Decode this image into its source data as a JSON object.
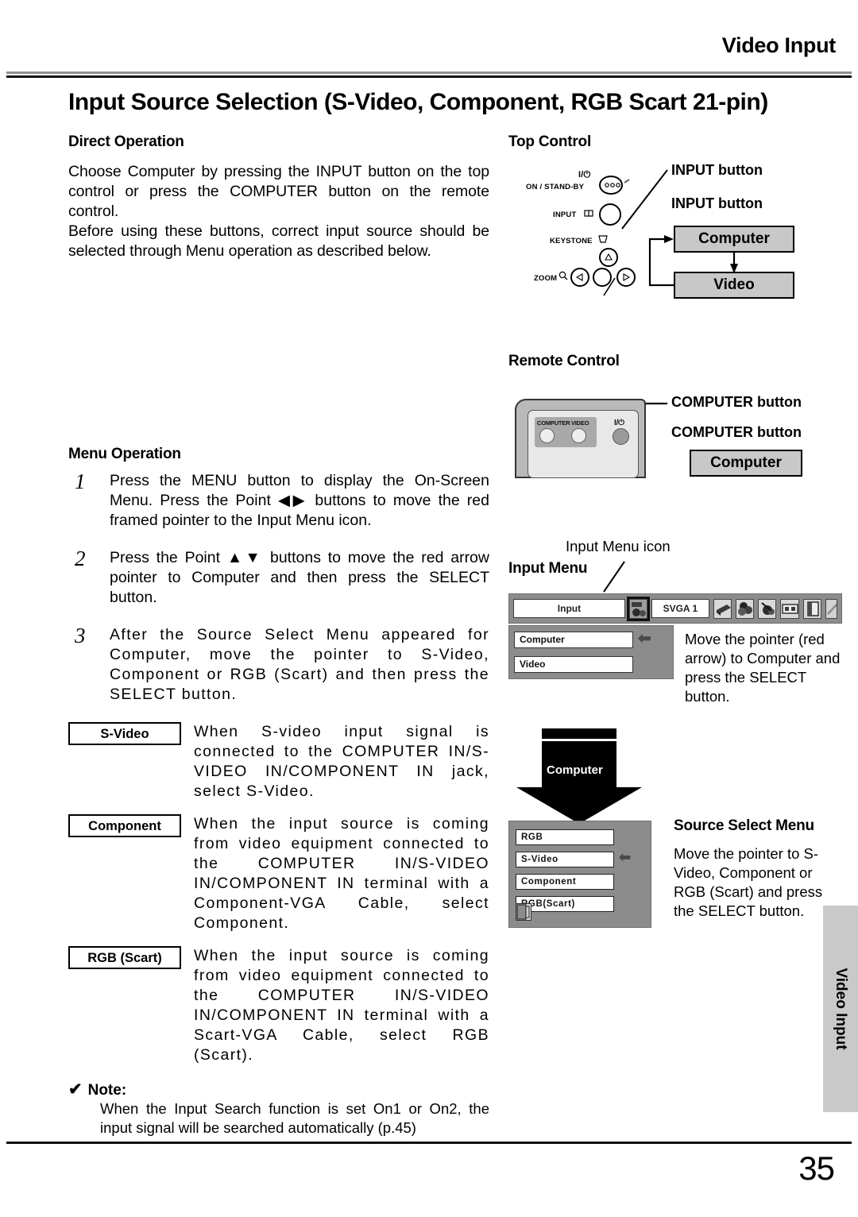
{
  "header": {
    "running_head": "Video Input"
  },
  "title": "Input Source Selection (S-Video, Component, RGB Scart 21-pin)",
  "direct_operation": {
    "heading": "Direct Operation",
    "paragraph1": "Choose Computer by pressing the INPUT button on the top control or press the COMPUTER button on the remote control.",
    "paragraph2": "Before using these buttons, correct input source should be selected through Menu operation as described below."
  },
  "menu_operation": {
    "heading": "Menu Operation",
    "steps": [
      {
        "num": "1",
        "text": "Press the MENU button to display the On-Screen Menu.  Press the Point ◀▶ buttons to move the red framed pointer to the Input Menu icon."
      },
      {
        "num": "2",
        "text": "Press the Point ▲▼ buttons to move the red arrow pointer to Computer and then press the SELECT button."
      },
      {
        "num": "3",
        "text": "After the Source Select Menu appeared for Computer, move the pointer to S-Video, Component or RGB (Scart) and then press the SELECT button."
      }
    ],
    "sources": [
      {
        "tag": "S-Video",
        "text": "When S-video input signal is connected to the COMPUTER IN/S-VIDEO IN/COMPONENT IN jack, select S-Video."
      },
      {
        "tag": "Component",
        "text": "When the input source is coming from video equipment connected to the COMPUTER IN/S-VIDEO IN/COMPONENT IN terminal with a Component-VGA Cable, select Component."
      },
      {
        "tag": "RGB (Scart)",
        "text": "When the input source is coming from video equipment connected to the COMPUTER IN/S-VIDEO IN/COMPONENT IN terminal with a Scart-VGA Cable, select RGB (Scart)."
      }
    ]
  },
  "note": {
    "check": "✔",
    "heading": "Note:",
    "text": "When the Input Search function is set On1 or On2, the input signal will be searched automatically (p.45)"
  },
  "top_control": {
    "heading": "Top Control",
    "callout_1": "INPUT button",
    "callout_2": "INPUT button",
    "labels": {
      "power_sym": "I/⏻",
      "power": "ON / STAND-BY",
      "input": "INPUT",
      "keystone": "KEYSTONE",
      "zoom": "ZOOM"
    },
    "flow": [
      "Computer",
      "Video"
    ]
  },
  "remote_control": {
    "heading": "Remote Control",
    "callout_1": "COMPUTER button",
    "callout_2": "COMPUTER button",
    "flow_label": "Computer",
    "keys": {
      "computer": "COMPUTER",
      "video": "VIDEO",
      "power": "I/⏻"
    }
  },
  "input_menu": {
    "heading": "Input Menu",
    "icon_callout": "Input Menu icon",
    "osd_title": "Input",
    "osd_mode": "SVGA 1",
    "items": [
      "Computer",
      "Video"
    ],
    "caption": "Move the pointer (red arrow) to Computer and press the SELECT button."
  },
  "source_select_menu": {
    "heading": "Source Select Menu",
    "arrow_label": "Computer",
    "items": [
      "RGB",
      "S-Video",
      "Component",
      "RGB(Scart)"
    ],
    "selected": "S-Video",
    "caption": "Move the pointer to S-Video, Component or RGB (Scart) and press the SELECT button."
  },
  "side_tab": {
    "label": "Video Input"
  },
  "footer": {
    "page_number": "35"
  },
  "colors": {
    "osd_background": "#8c8c8c",
    "flow_box": "#c8c8c8",
    "side_tab": "#c9c9c9",
    "rule": "#111111"
  }
}
